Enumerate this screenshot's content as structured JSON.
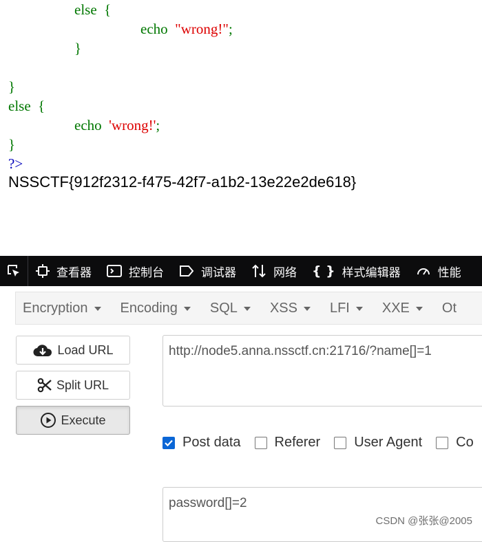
{
  "code": {
    "line1_kw": "else",
    "line1_brace": "{",
    "line2_kw": "echo",
    "line2_str": "\"wrong!\"",
    "line2_end": ";",
    "line3": "}",
    "line4": "}",
    "line5_kw": "else",
    "line5_brace": "{",
    "line6_kw": "echo",
    "line6_str": "'wrong!'",
    "line6_end": ";",
    "line7": "}",
    "line8": "?>",
    "flag": "NSSCTF{912f2312-f475-42f7-a1b2-13e22e2de618}"
  },
  "devtools": {
    "tabs": [
      {
        "label": "查看器",
        "icon": "inspector-icon"
      },
      {
        "label": "控制台",
        "icon": "console-icon"
      },
      {
        "label": "调试器",
        "icon": "debugger-icon"
      },
      {
        "label": "网络",
        "icon": "network-icon"
      },
      {
        "label": "样式编辑器",
        "icon": "braces-icon"
      },
      {
        "label": "性能",
        "icon": "performance-icon"
      }
    ]
  },
  "hackbar": {
    "menu": [
      "Encryption",
      "Encoding",
      "SQL",
      "XSS",
      "LFI",
      "XXE",
      "Ot"
    ],
    "buttons": {
      "load": "Load URL",
      "split": "Split URL",
      "execute": "Execute"
    },
    "url": "http://node5.anna.nssctf.cn:21716/?name[]=1",
    "checkboxes": [
      {
        "label": "Post data",
        "checked": true
      },
      {
        "label": "Referer",
        "checked": false
      },
      {
        "label": "User Agent",
        "checked": false
      },
      {
        "label": "Co",
        "checked": false
      }
    ],
    "post_body": "password[]=2"
  },
  "watermark": "CSDN @张张@2005",
  "colors": {
    "keyword": "#007700",
    "string": "#dd0000",
    "php_tag": "#0000bb",
    "devtools_bg": "#0c0c0d",
    "checkbox_on": "#0a66d6"
  }
}
